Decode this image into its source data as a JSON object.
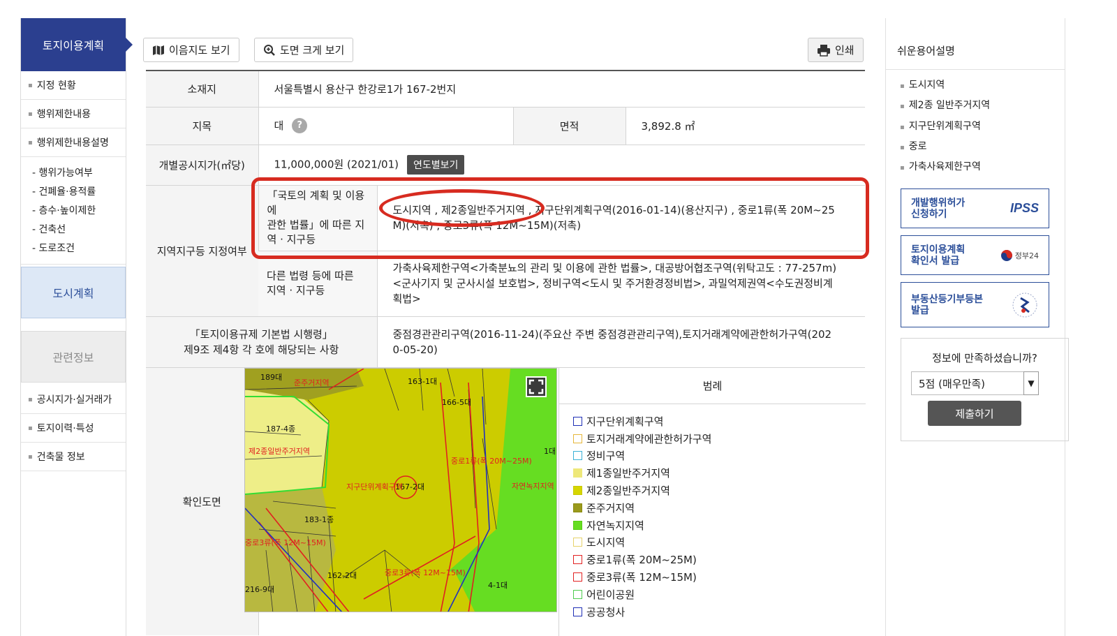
{
  "sidebar": {
    "header": "토지이용계획",
    "items": [
      "지정 현황",
      "행위제한내용",
      "행위제한내용설명"
    ],
    "subitems": [
      "- 행위가능여부",
      "- 건폐율·용적률",
      "- 층수·높이제한",
      "- 건축선",
      "- 도로조건"
    ],
    "box_city": "도시계획",
    "box_related": "관련정보",
    "bottom_items": [
      "공시지가·실거래가",
      "토지이력·특성",
      "건축물 정보"
    ]
  },
  "toolbar": {
    "map_btn": "이음지도 보기",
    "zoom_btn": "도면 크게 보기",
    "print_btn": "인쇄"
  },
  "table": {
    "location_label": "소재지",
    "location_value": "서울특별시 용산구 한강로1가 167-2번지",
    "jimok_label": "지목",
    "jimok_value": "대",
    "help": "?",
    "area_label": "면적",
    "area_value": "3,892.8 ㎡",
    "price_label": "개별공시지가(㎡당)",
    "price_value": "11,000,000원 (2021/01)",
    "year_btn": "연도별보기",
    "zone_label": "지역지구등 지정여부",
    "zone_sub1_l1": "「국토의 계획 및 이용에",
    "zone_sub1_l2": "관한 법률」에 따른 지",
    "zone_sub1_l3": "역 · 지구등",
    "zone_sub1_v1": "도시지역 , 제2종일반주거지역 , 지구단위계획구역(2016-01-14)(용산지구) , 중로1류(폭 20M~25",
    "zone_sub1_v2": "M)(저촉) , 중로3류(폭 12M~15M)(저촉)",
    "zone_sub2_l1": "다른 법령 등에 따른",
    "zone_sub2_l2": "지역 · 지구등",
    "zone_sub2_v1": "가축사육제한구역<가축분뇨의 관리 및 이용에 관한 법률>, 대공방어협조구역(위탁고도 : 77-257m)",
    "zone_sub2_v2": "<군사기지 및 군사시설 보호법>, 정비구역<도시 및 주거환경정비법>, 과밀억제권역<수도권정비계",
    "zone_sub2_v3": "획법>",
    "reg_label_l1": "「토지이용규제 기본법 시행령」",
    "reg_label_l2": "제9조 제4항 각 호에 해당되는 사항",
    "reg_v1": "중점경관관리구역(2016-11-24)(주요산 주변 중점경관관리구역),토지거래계약에관한허가구역(202",
    "reg_v2": "0-05-20)",
    "map_label": "확인도면"
  },
  "map_labels": {
    "l1": "189대",
    "l2": "준주거지역",
    "l3": "163-1대",
    "l4": "166-5대",
    "l5": "187-4종",
    "l6": "제2종일반주거지역",
    "l7": "중로1류(폭 20M~25M)",
    "l8": "지구단위계획구역",
    "l9": "167-2대",
    "l10": "자연녹지지역",
    "l11": "183-1종",
    "l12": "중로3류(폭 12M~15M)",
    "l13": "4-1대",
    "l14": "1대",
    "l15": "중로3류(폭 12M~15M)",
    "l16": "216-9대",
    "l17": "162-2대"
  },
  "legend": {
    "title": "범례",
    "items": [
      {
        "label": "지구단위계획구역",
        "fill": "#ffffff",
        "border": "#1f2fb5"
      },
      {
        "label": "토지거래계약에관한허가구역",
        "fill": "#ffffff",
        "border": "#e6b73b"
      },
      {
        "label": "정비구역",
        "fill": "#ffffff",
        "border": "#3bb1d6"
      },
      {
        "label": "제1종일반주거지역",
        "fill": "#eee87a",
        "border": "#eee87a"
      },
      {
        "label": "제2종일반주거지역",
        "fill": "#d6d600",
        "border": "#c8c800"
      },
      {
        "label": "준주거지역",
        "fill": "#9a9a1c",
        "border": "#8a8a10"
      },
      {
        "label": "자연녹지지역",
        "fill": "#66dd22",
        "border": "#55cc11"
      },
      {
        "label": "도시지역",
        "fill": "#ffffff",
        "border": "#e6d26b"
      },
      {
        "label": "중로1류(폭 20M~25M)",
        "fill": "#ffffff",
        "border": "#e22222"
      },
      {
        "label": "중로3류(폭 12M~15M)",
        "fill": "#ffffff",
        "border": "#e22222"
      },
      {
        "label": "어린이공원",
        "fill": "#ffffff",
        "border": "#4ecb4e"
      },
      {
        "label": "공공청사",
        "fill": "#ffffff",
        "border": "#1f2fb5"
      }
    ]
  },
  "right_sidebar": {
    "title": "쉬운용어설명",
    "terms": [
      "도시지역",
      "제2종 일반주거지역",
      "지구단위계획구역",
      "중로",
      "가축사육제한구역"
    ],
    "svc1_l1": "개발행위허가",
    "svc1_l2": "신청하기",
    "svc1_logo": "IPSS",
    "svc2_l1": "토지이용계획",
    "svc2_l2": "확인서 발급",
    "svc2_logo": "정부24",
    "svc3_l1": "부동산등기부등본",
    "svc3_l2": "발급",
    "survey_q": "정보에 만족하셨습니까?",
    "survey_value": "5점 (매우만족)",
    "survey_btn": "제출하기"
  }
}
